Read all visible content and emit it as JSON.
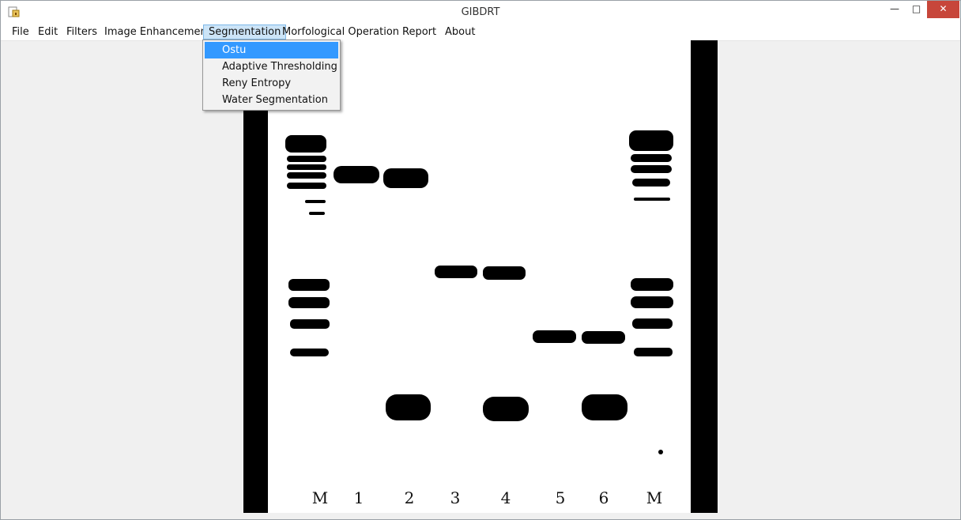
{
  "window": {
    "title": "GIBDRT",
    "controls": {
      "minimize": "—",
      "maximize": "□",
      "close": "✕"
    }
  },
  "menubar": {
    "items": [
      "File",
      "Edit",
      "Filters",
      "Image Enhancement",
      "Segmentation",
      "Morfological Operation",
      "Report",
      "About"
    ],
    "active": "Segmentation"
  },
  "segmentation_menu": {
    "items": [
      "Ostu",
      "Adaptive Thresholding",
      "Reny Entropy",
      "Water Segmentation"
    ],
    "highlighted": "Ostu"
  },
  "gel_image": {
    "lane_labels": [
      "M",
      "1",
      "2",
      "3",
      "4",
      "5",
      "6",
      "M"
    ]
  },
  "colors": {
    "highlight": "#3399ff",
    "close_button": "#c7463a"
  }
}
